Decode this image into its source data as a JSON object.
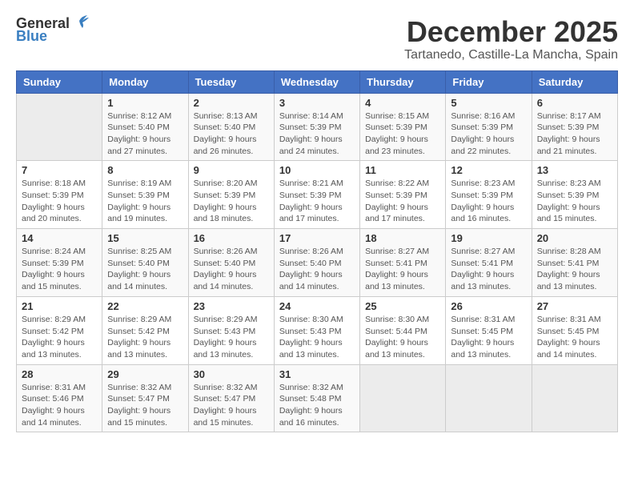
{
  "header": {
    "logo_general": "General",
    "logo_blue": "Blue",
    "month_title": "December 2025",
    "subtitle": "Tartanedo, Castille-La Mancha, Spain"
  },
  "days_of_week": [
    "Sunday",
    "Monday",
    "Tuesday",
    "Wednesday",
    "Thursday",
    "Friday",
    "Saturday"
  ],
  "weeks": [
    [
      {
        "day": "",
        "info": ""
      },
      {
        "day": "1",
        "info": "Sunrise: 8:12 AM\nSunset: 5:40 PM\nDaylight: 9 hours\nand 27 minutes."
      },
      {
        "day": "2",
        "info": "Sunrise: 8:13 AM\nSunset: 5:40 PM\nDaylight: 9 hours\nand 26 minutes."
      },
      {
        "day": "3",
        "info": "Sunrise: 8:14 AM\nSunset: 5:39 PM\nDaylight: 9 hours\nand 24 minutes."
      },
      {
        "day": "4",
        "info": "Sunrise: 8:15 AM\nSunset: 5:39 PM\nDaylight: 9 hours\nand 23 minutes."
      },
      {
        "day": "5",
        "info": "Sunrise: 8:16 AM\nSunset: 5:39 PM\nDaylight: 9 hours\nand 22 minutes."
      },
      {
        "day": "6",
        "info": "Sunrise: 8:17 AM\nSunset: 5:39 PM\nDaylight: 9 hours\nand 21 minutes."
      }
    ],
    [
      {
        "day": "7",
        "info": "Sunrise: 8:18 AM\nSunset: 5:39 PM\nDaylight: 9 hours\nand 20 minutes."
      },
      {
        "day": "8",
        "info": "Sunrise: 8:19 AM\nSunset: 5:39 PM\nDaylight: 9 hours\nand 19 minutes."
      },
      {
        "day": "9",
        "info": "Sunrise: 8:20 AM\nSunset: 5:39 PM\nDaylight: 9 hours\nand 18 minutes."
      },
      {
        "day": "10",
        "info": "Sunrise: 8:21 AM\nSunset: 5:39 PM\nDaylight: 9 hours\nand 17 minutes."
      },
      {
        "day": "11",
        "info": "Sunrise: 8:22 AM\nSunset: 5:39 PM\nDaylight: 9 hours\nand 17 minutes."
      },
      {
        "day": "12",
        "info": "Sunrise: 8:23 AM\nSunset: 5:39 PM\nDaylight: 9 hours\nand 16 minutes."
      },
      {
        "day": "13",
        "info": "Sunrise: 8:23 AM\nSunset: 5:39 PM\nDaylight: 9 hours\nand 15 minutes."
      }
    ],
    [
      {
        "day": "14",
        "info": "Sunrise: 8:24 AM\nSunset: 5:39 PM\nDaylight: 9 hours\nand 15 minutes."
      },
      {
        "day": "15",
        "info": "Sunrise: 8:25 AM\nSunset: 5:40 PM\nDaylight: 9 hours\nand 14 minutes."
      },
      {
        "day": "16",
        "info": "Sunrise: 8:26 AM\nSunset: 5:40 PM\nDaylight: 9 hours\nand 14 minutes."
      },
      {
        "day": "17",
        "info": "Sunrise: 8:26 AM\nSunset: 5:40 PM\nDaylight: 9 hours\nand 14 minutes."
      },
      {
        "day": "18",
        "info": "Sunrise: 8:27 AM\nSunset: 5:41 PM\nDaylight: 9 hours\nand 13 minutes."
      },
      {
        "day": "19",
        "info": "Sunrise: 8:27 AM\nSunset: 5:41 PM\nDaylight: 9 hours\nand 13 minutes."
      },
      {
        "day": "20",
        "info": "Sunrise: 8:28 AM\nSunset: 5:41 PM\nDaylight: 9 hours\nand 13 minutes."
      }
    ],
    [
      {
        "day": "21",
        "info": "Sunrise: 8:29 AM\nSunset: 5:42 PM\nDaylight: 9 hours\nand 13 minutes."
      },
      {
        "day": "22",
        "info": "Sunrise: 8:29 AM\nSunset: 5:42 PM\nDaylight: 9 hours\nand 13 minutes."
      },
      {
        "day": "23",
        "info": "Sunrise: 8:29 AM\nSunset: 5:43 PM\nDaylight: 9 hours\nand 13 minutes."
      },
      {
        "day": "24",
        "info": "Sunrise: 8:30 AM\nSunset: 5:43 PM\nDaylight: 9 hours\nand 13 minutes."
      },
      {
        "day": "25",
        "info": "Sunrise: 8:30 AM\nSunset: 5:44 PM\nDaylight: 9 hours\nand 13 minutes."
      },
      {
        "day": "26",
        "info": "Sunrise: 8:31 AM\nSunset: 5:45 PM\nDaylight: 9 hours\nand 13 minutes."
      },
      {
        "day": "27",
        "info": "Sunrise: 8:31 AM\nSunset: 5:45 PM\nDaylight: 9 hours\nand 14 minutes."
      }
    ],
    [
      {
        "day": "28",
        "info": "Sunrise: 8:31 AM\nSunset: 5:46 PM\nDaylight: 9 hours\nand 14 minutes."
      },
      {
        "day": "29",
        "info": "Sunrise: 8:32 AM\nSunset: 5:47 PM\nDaylight: 9 hours\nand 15 minutes."
      },
      {
        "day": "30",
        "info": "Sunrise: 8:32 AM\nSunset: 5:47 PM\nDaylight: 9 hours\nand 15 minutes."
      },
      {
        "day": "31",
        "info": "Sunrise: 8:32 AM\nSunset: 5:48 PM\nDaylight: 9 hours\nand 16 minutes."
      },
      {
        "day": "",
        "info": ""
      },
      {
        "day": "",
        "info": ""
      },
      {
        "day": "",
        "info": ""
      }
    ]
  ]
}
